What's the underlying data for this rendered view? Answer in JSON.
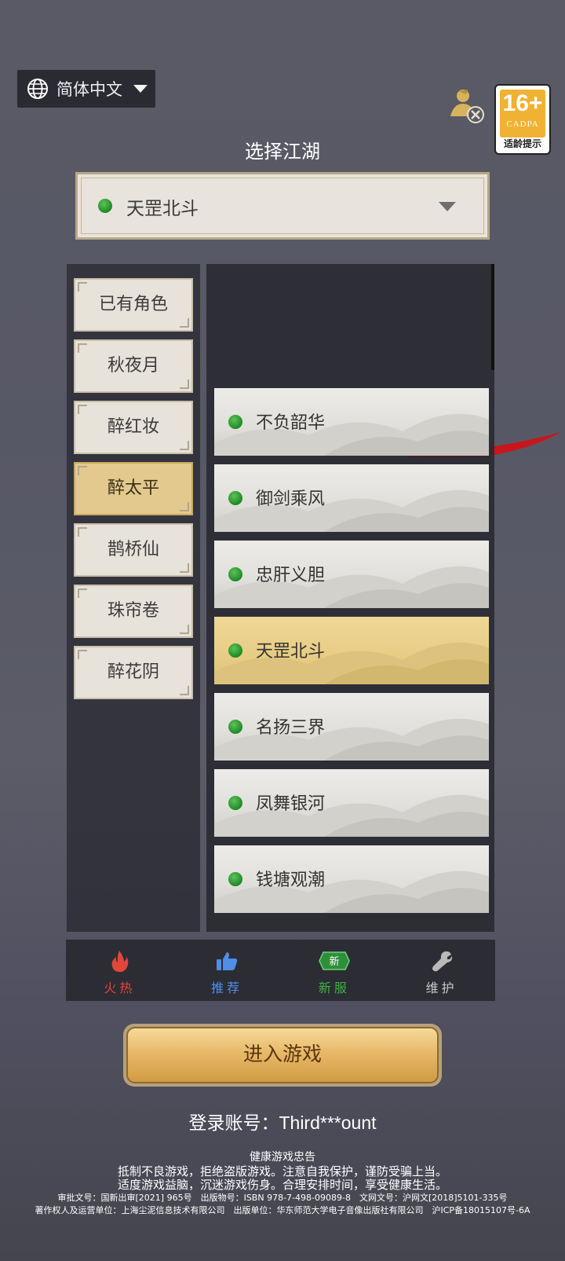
{
  "language": {
    "label": "简体中文"
  },
  "heading": "选择江湖",
  "age_rating": {
    "number": "16+",
    "org": "CADPA",
    "tip": "适龄提示"
  },
  "selected_server": "天罡北斗",
  "categories": [
    {
      "label": "已有角色"
    },
    {
      "label": "秋夜月"
    },
    {
      "label": "醉红妆"
    },
    {
      "label": "醉太平",
      "selected": true
    },
    {
      "label": "鹊桥仙"
    },
    {
      "label": "珠帘卷"
    },
    {
      "label": "醉花阴"
    }
  ],
  "servers": [
    {
      "name": "不负韶华",
      "status": "green"
    },
    {
      "name": "御剑乘风",
      "status": "green"
    },
    {
      "name": "忠肝义胆",
      "status": "green"
    },
    {
      "name": "天罡北斗",
      "status": "green",
      "selected": true
    },
    {
      "name": "名扬三界",
      "status": "green"
    },
    {
      "name": "凤舞银河",
      "status": "green"
    },
    {
      "name": "钱塘观潮",
      "status": "green"
    }
  ],
  "tabs": [
    {
      "label": "火热",
      "icon": "fire-icon",
      "color": "#e0473a"
    },
    {
      "label": "推荐",
      "icon": "thumbs-up-icon",
      "color": "#4f8fe8"
    },
    {
      "label": "新服",
      "icon": "new-badge-icon",
      "color": "#3fb04a",
      "badge": "新"
    },
    {
      "label": "维护",
      "icon": "wrench-icon",
      "color": "#b9b9b9"
    }
  ],
  "enter_button": "进入游戏",
  "account": "登录账号：Third***ount",
  "notice": {
    "title": "健康游戏忠告",
    "line1": "抵制不良游戏，拒绝盗版游戏。注意自我保护，谨防受骗上当。",
    "line2": "适度游戏益脑，沉迷游戏伤身。合理安排时间，享受健康生活。",
    "line3": "审批文号：国新出审[2021] 965号　出版物号：ISBN 978-7-498-09089-8　文网文号：沪网文[2018]5101-335号",
    "line4": "著作权人及运营单位：上海尘泥信息技术有限公司　出版单位：华东师范大学电子音像出版社有限公司　沪ICP备18015107号-6A"
  },
  "colors": {
    "status_green": "#2e9a33",
    "selected_gold": "#e3c98d",
    "button_gold": "#e7b968"
  }
}
